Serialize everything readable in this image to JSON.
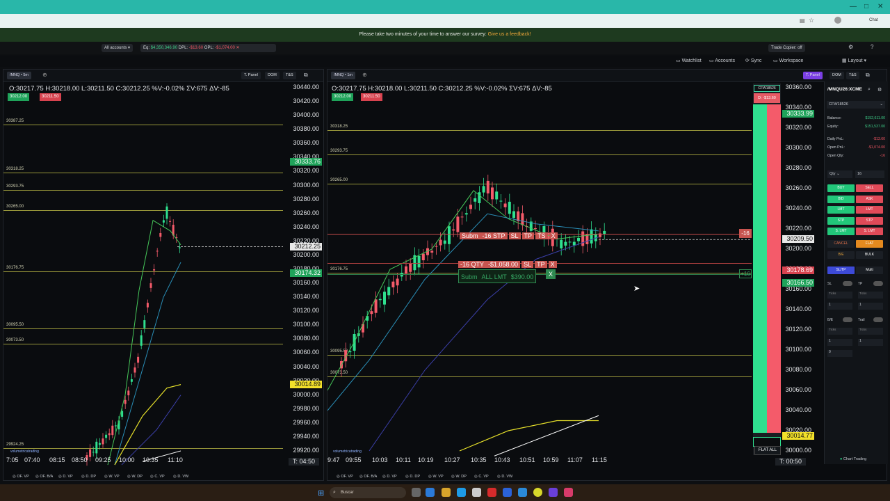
{
  "browser": {
    "chat_label": "Chat"
  },
  "survey": {
    "text": "Please take two minutes of your time to answer our survey:",
    "link": "Give us a feedback!"
  },
  "account_bar": {
    "accounts": "All accounts",
    "eq_label": "Eq:",
    "eq_value": "$4,350,346.90",
    "dpl_label": "DPL:",
    "dpl_value": "-$13.60",
    "opl_label": "OPL:",
    "opl_value": "-$1,074.00",
    "trade_copier": "Trade Copier: off"
  },
  "menu": {
    "watchlist": "Watchlist",
    "accounts": "Accounts",
    "sync": "Sync",
    "workspace": "Workspace",
    "layout": "Layout"
  },
  "left_chart": {
    "symbol_tab": "/MNQ • 5m",
    "btn_tpanel": "T. Panel",
    "btn_dom": "DOM",
    "btn_ts": "T&S",
    "ohlc": "O:30217.75 H:30218.00 L:30211.50 C:30212.25 %V:-0.02% ΣV:675 ΔV:-85",
    "bid_badge": "30212.00",
    "ask_badge": "30211.50",
    "levels": [
      "30387.25",
      "30318.25",
      "30293.75",
      "30265.00",
      "30176.75",
      "30095.50",
      "30073.50",
      "29924.25"
    ],
    "y_ticks": [
      "30440.00",
      "30420.00",
      "30400.00",
      "30380.00",
      "30360.00",
      "30340.00",
      "30320.00",
      "30300.00",
      "30280.00",
      "30260.00",
      "30240.00",
      "30220.00",
      "30200.00",
      "30180.00",
      "30160.00",
      "30140.00",
      "30120.00",
      "30100.00",
      "30080.00",
      "30060.00",
      "30040.00",
      "30020.00",
      "30000.00",
      "29980.00",
      "29960.00",
      "29940.00",
      "29920.00"
    ],
    "price_marks": {
      "green_top": "30333.76",
      "last": "30212.25",
      "green_mid": "30174.32",
      "yellow": "30014.89"
    },
    "x_ticks": [
      "7:05",
      "07:40",
      "08:15",
      "08:50",
      "09:25",
      "10:00",
      "10:35",
      "11:10"
    ],
    "timer": "T: 04:50",
    "watermark": "volumetricatrading",
    "bottom_tabs": [
      "OF. VP",
      "OF. B/A",
      "D. VP",
      "D. DP",
      "W. VP",
      "W. DP",
      "C. VP",
      "D. VW"
    ]
  },
  "right_chart": {
    "symbol_tab": "/MNQ • 1m",
    "btn_tpanel": "T. Panel",
    "btn_dom": "DOM",
    "btn_ts": "T&S",
    "ohlc": "O:30217.75 H:30218.00 L:30211.50 C:30212.25 %V:-0.02% ΣV:675 ΔV:-85",
    "bid_badge": "30212.00",
    "ask_badge": "30211.50",
    "levels": [
      "30318.25",
      "30293.75",
      "30265.00",
      "30176.75",
      "30095.50",
      "30073.50"
    ],
    "y_ticks": [
      "30360.00",
      "30340.00",
      "30320.00",
      "30300.00",
      "30280.00",
      "30260.00",
      "30240.00",
      "30220.00",
      "30200.00",
      "30180.00",
      "30160.00",
      "30140.00",
      "30120.00",
      "30100.00",
      "30080.00",
      "30060.00",
      "30040.00",
      "30020.00",
      "30000.00"
    ],
    "price_marks": {
      "green_top": "30333.99",
      "last": "30209.50",
      "red": "30178.69",
      "green_mid": "30166.50",
      "yellow": "30014.77"
    },
    "x_ticks": [
      "9:47",
      "09:55",
      "10:03",
      "10:11",
      "10:19",
      "10:27",
      "10:35",
      "10:43",
      "10:51",
      "10:59",
      "11:07",
      "11:15"
    ],
    "timer": "T: 00:50",
    "watermark": "volumetricatrading",
    "order_stp": [
      "Subm",
      "-16 STP",
      "SL",
      "TP",
      "TS",
      "X"
    ],
    "order_pos": [
      "-16 QTY",
      "-$1,058.00",
      "SL",
      "TP",
      "X"
    ],
    "order_lmt": [
      "Subm",
      "ALL LMT",
      "$390.00",
      "X"
    ],
    "qty_marker_red": "-16",
    "qty_marker_green": "+16",
    "account_tag": "CFW18526",
    "account_pnl": "D: -$13.60",
    "flat_all": "FLAT ALL",
    "bottom_tabs": [
      "OF. VP",
      "OF. B/A",
      "D. VP",
      "D. DP",
      "W. VP",
      "W. DP",
      "C. VP",
      "D. VW"
    ]
  },
  "trade_panel": {
    "symbol": "/MNQU26:XCME",
    "account": "CFW18526",
    "balance_label": "Balance:",
    "balance": "$152,611.00",
    "equity_label": "Equity:",
    "equity": "$151,537.00",
    "daily_pnl_label": "Daily PnL:",
    "daily_pnl": "-$13.60",
    "open_pnl_label": "Open PnL:",
    "open_pnl": "-$1,074.00",
    "open_qty_label": "Open Qty:",
    "open_qty": "-16",
    "qty_label": "Qty",
    "qty_value": "16",
    "buttons": {
      "buy": "BUY",
      "sell": "SELL",
      "bid": "BID",
      "ask": "ASK",
      "lmt_b": "LMT",
      "lmt_s": "LMT",
      "stp_b": "STP",
      "stp_s": "STP",
      "slmt_b": "S. LMT",
      "slmt_s": "S. LMT",
      "cancel": "CANCEL",
      "flat": "FLAT",
      "be": "B/E",
      "bulk": "BULK"
    },
    "tab_sltp": "SL/TP",
    "tab_multi": "Multi",
    "sl_label": "SL",
    "tp_label": "TP",
    "ticks_label": "Ticks",
    "be_label": "B/E",
    "trail_label": "Trail",
    "one": "1",
    "zero": "0",
    "chart_trading": "Chart Trading"
  },
  "taskbar": {
    "search_placeholder": "Buscar"
  }
}
